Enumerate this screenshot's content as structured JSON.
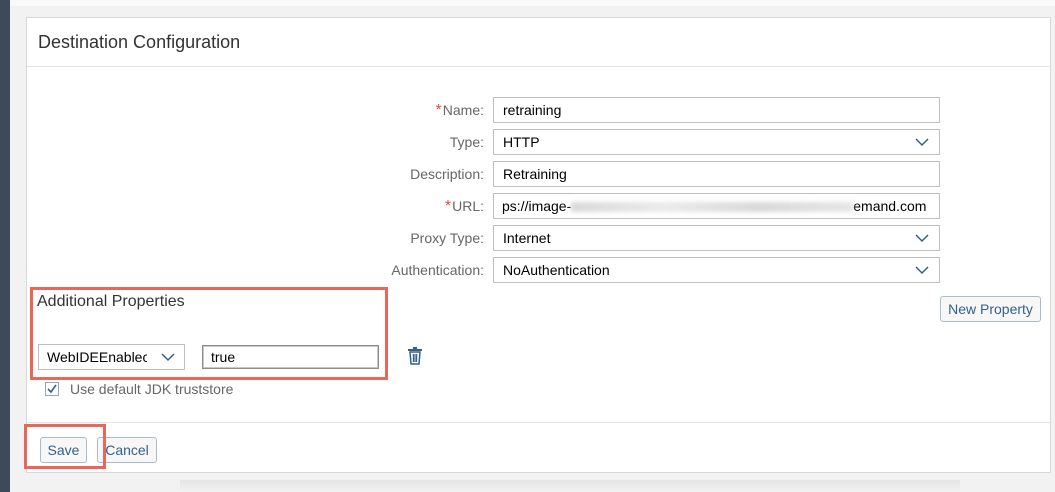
{
  "panel": {
    "title": "Destination Configuration"
  },
  "form": {
    "name": {
      "label": "Name:",
      "required": true,
      "value": "retraining"
    },
    "type": {
      "label": "Type:",
      "value": "HTTP"
    },
    "description": {
      "label": "Description:",
      "value": "Retraining"
    },
    "url": {
      "label": "URL:",
      "required": true,
      "value_start": "ps://image-",
      "value_end": "emand.com"
    },
    "proxy_type": {
      "label": "Proxy Type:",
      "value": "Internet"
    },
    "authentication": {
      "label": "Authentication:",
      "value": "NoAuthentication"
    },
    "required_marker": "*"
  },
  "additional_properties": {
    "title": "Additional Properties",
    "new_property_label": "New Property",
    "property": {
      "key": "WebIDEEnablec",
      "value": "true"
    }
  },
  "truststore": {
    "label": "Use default JDK truststore",
    "checked": true
  },
  "footer": {
    "save_label": "Save",
    "cancel_label": "Cancel"
  },
  "colors": {
    "accent": "#346187",
    "required": "#e34a4a",
    "highlight": "#e8675a",
    "sidebar": "#3c4a5c"
  },
  "icons": {
    "dropdown": "chevron-down-icon",
    "delete": "trash-icon",
    "check": "checkmark-icon"
  }
}
